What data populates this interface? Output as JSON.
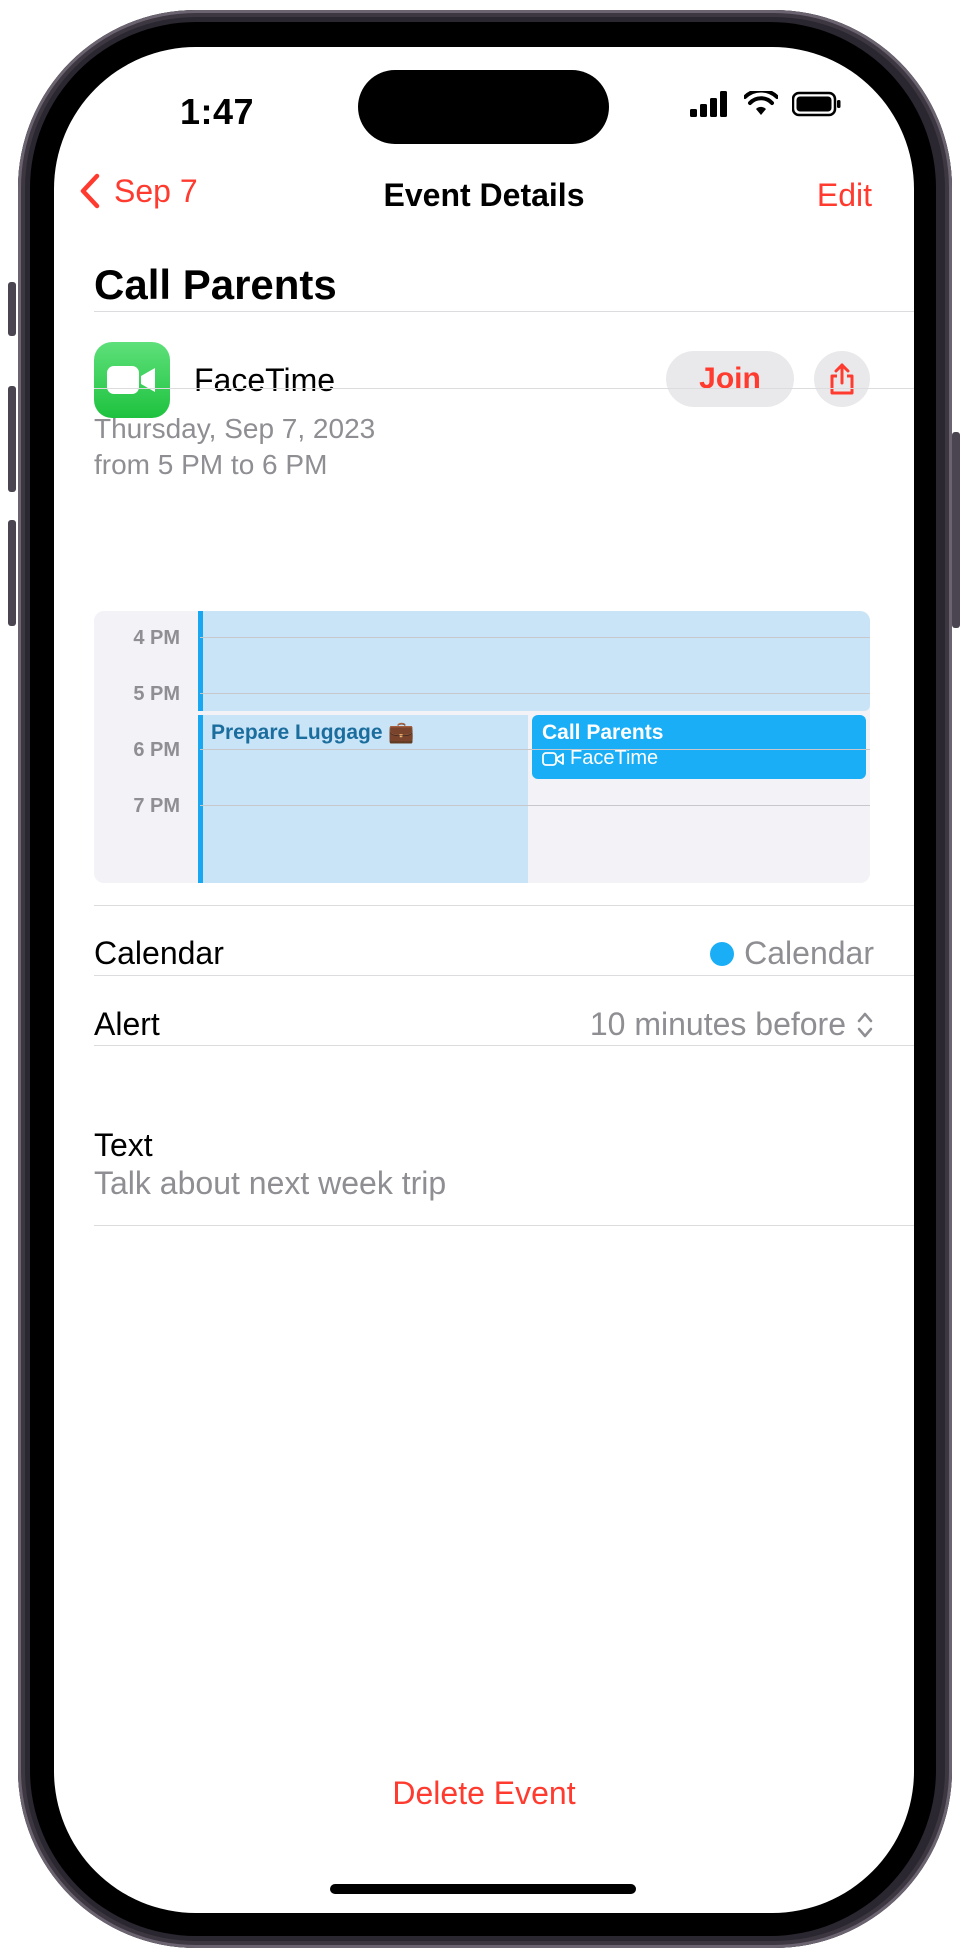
{
  "status_bar": {
    "time": "1:47"
  },
  "nav": {
    "back_label": "Sep 7",
    "title": "Event Details",
    "edit_label": "Edit"
  },
  "event": {
    "title": "Call Parents",
    "app": "FaceTime",
    "join_label": "Join",
    "date": "Thursday, Sep 7, 2023",
    "time_range": "from 5 PM to 6 PM"
  },
  "mini_calendar": {
    "hours": [
      "4 PM",
      "5 PM",
      "6 PM",
      "7 PM"
    ],
    "events": [
      {
        "title": "Prepare Luggage 💼"
      },
      {
        "title": "Call Parents",
        "subtitle": "FaceTime"
      }
    ]
  },
  "details": {
    "calendar_label": "Calendar",
    "calendar_value": "Calendar",
    "alert_label": "Alert",
    "alert_value": "10 minutes before",
    "text_label": "Text",
    "text_value": "Talk about next week trip"
  },
  "actions": {
    "delete_label": "Delete Event"
  },
  "colors": {
    "accent": "#ff3b30",
    "calendar_blue": "#1aaef6",
    "facetime_green": "#2bd14e"
  }
}
